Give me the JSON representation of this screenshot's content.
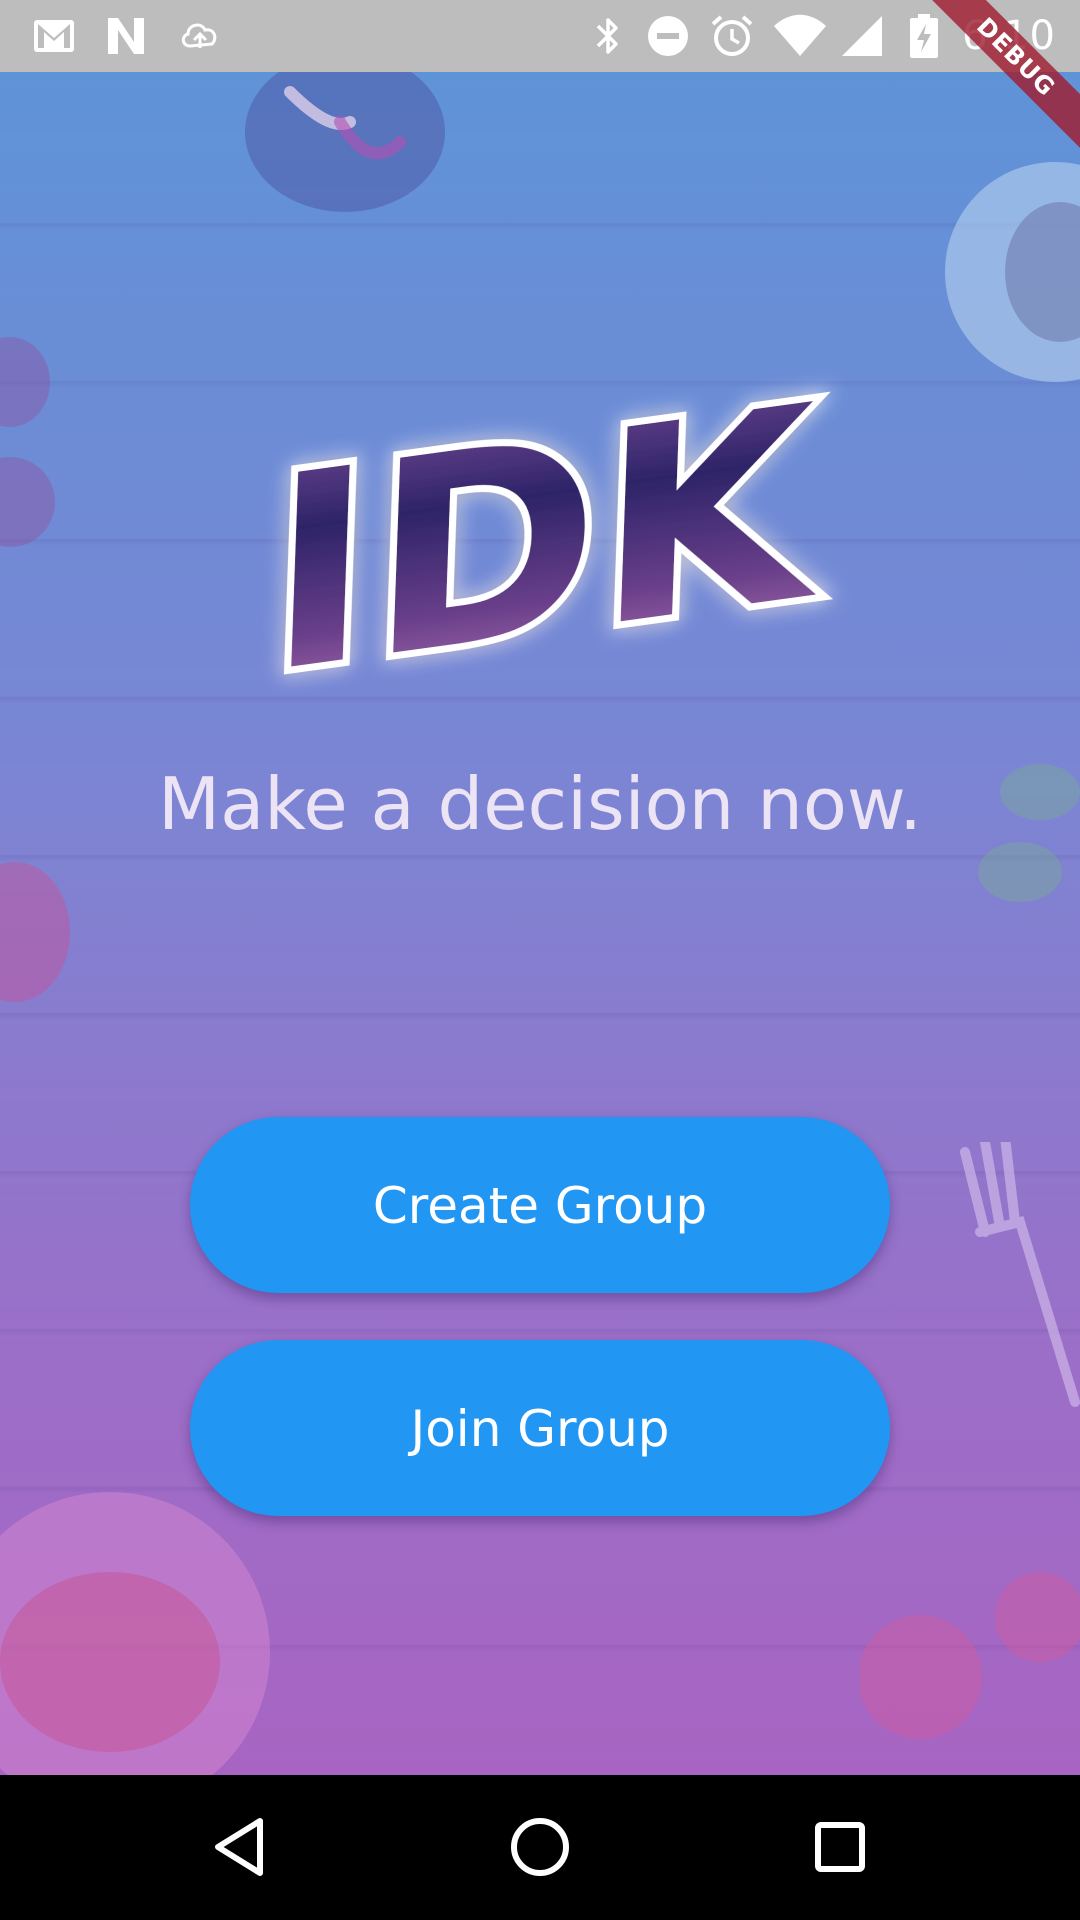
{
  "status_bar": {
    "time": "6:10",
    "left_icons": [
      "gmail-icon",
      "n-notification-icon",
      "cloud-upload-icon"
    ],
    "right_icons": [
      "bluetooth-icon",
      "do-not-disturb-icon",
      "alarm-icon",
      "wifi-icon",
      "signal-icon",
      "battery-charging-icon"
    ],
    "debug_label": "DEBUG"
  },
  "app": {
    "logo_text": "IDK",
    "tagline": "Make a decision now.",
    "create_button_label": "Create Group",
    "join_button_label": "Join Group"
  },
  "nav_bar": {
    "buttons": [
      "back-icon",
      "home-icon",
      "recents-icon"
    ]
  },
  "colors": {
    "status_bar": "#bdbdbd",
    "gradient_top": "#5f93d8",
    "gradient_bottom": "#a864c2",
    "button": "#2196f3",
    "button_text": "#ffffff",
    "logo_fill": "#3b2a6e",
    "nav_bar": "#000000"
  }
}
